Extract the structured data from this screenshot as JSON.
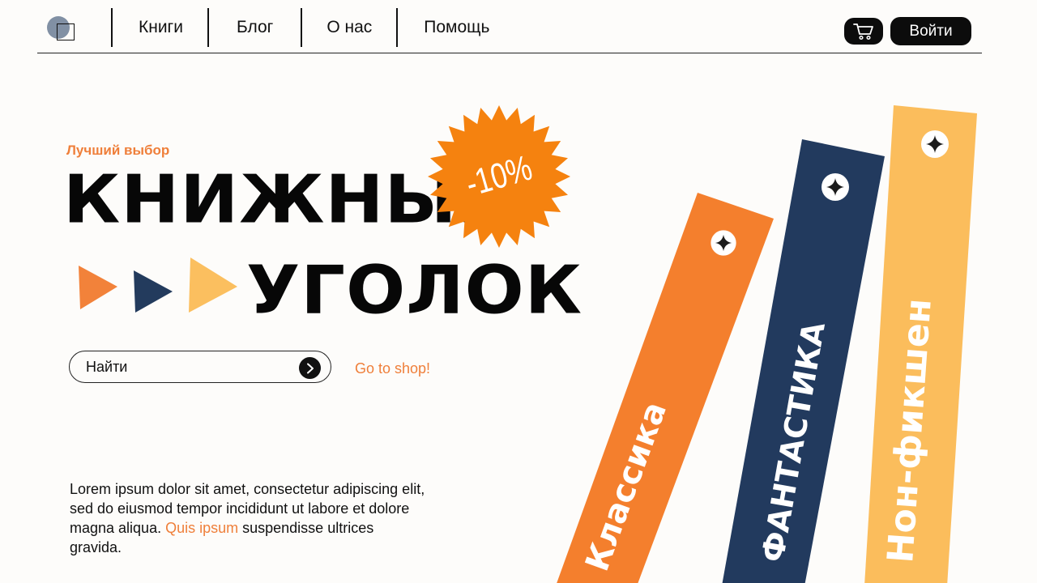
{
  "header": {
    "nav": [
      {
        "label": "Книги"
      },
      {
        "label": "Блог"
      },
      {
        "label": "О нас"
      },
      {
        "label": "Помощь"
      }
    ],
    "cart_icon": "cart-icon",
    "login_label": "Войти"
  },
  "hero": {
    "eyebrow": "Лучший выбор",
    "title_line1": "КНИЖНЫЙ",
    "title_line2": "УГОЛОК",
    "badge": "-10%"
  },
  "search": {
    "placeholder": "Найти",
    "button_icon": "chevron-right-icon"
  },
  "shop_link": "Go to shop!",
  "paragraph": {
    "before": "Lorem ipsum dolor sit amet, consectetur adipiscing elit, sed do eiusmod tempor incididunt ut labore et dolore magna aliqua. ",
    "accent": "Quis ipsum",
    "after": " suspendisse ultrices gravida."
  },
  "categories": [
    {
      "label": "Классика",
      "color": "#f47f2d"
    },
    {
      "label": "ФАНТАСТИКА",
      "color": "#223a5e"
    },
    {
      "label": "Нон-фикшен",
      "color": "#fbbd5c"
    }
  ],
  "colors": {
    "accent": "#ef7f3a",
    "badge": "#f5820f",
    "arrow1": "#f2823a",
    "arrow2": "#233b5d",
    "arrow3": "#fbbf5f",
    "dark": "#0c0c0c"
  }
}
